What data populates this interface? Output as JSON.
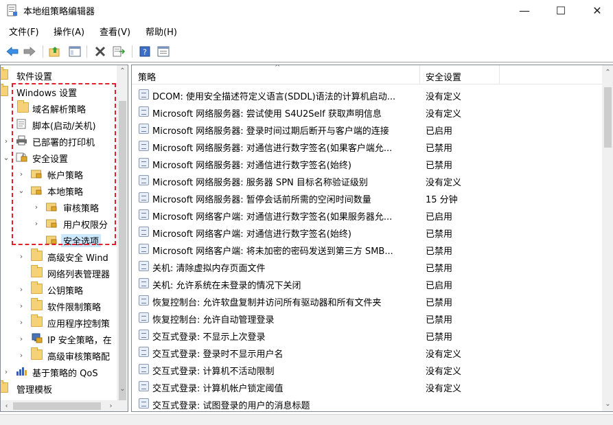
{
  "window": {
    "title": "本地组策略编辑器",
    "minimize": "—",
    "maximize": "☐",
    "close": "✕"
  },
  "menu": [
    {
      "label": "文件(F)"
    },
    {
      "label": "操作(A)"
    },
    {
      "label": "查看(V)"
    },
    {
      "label": "帮助(H)"
    }
  ],
  "toolbar": {
    "icons": [
      "back-icon",
      "forward-icon",
      "up-folder-icon",
      "show-hide-tree-icon",
      "delete-icon",
      "export-list-icon",
      "help-icon",
      "properties-view-icon"
    ]
  },
  "tree": {
    "items": [
      {
        "label": "软件设置"
      },
      {
        "label": "Windows 设置"
      },
      {
        "label": "域名解析策略"
      },
      {
        "label": "脚本(启动/关机)"
      },
      {
        "label": "已部署的打印机"
      },
      {
        "label": "安全设置"
      },
      {
        "label": "帐户策略"
      },
      {
        "label": "本地策略"
      },
      {
        "label": "审核策略"
      },
      {
        "label": "用户权限分"
      },
      {
        "label": "安全选项"
      },
      {
        "label": "高级安全 Wind"
      },
      {
        "label": "网络列表管理器"
      },
      {
        "label": "公钥策略"
      },
      {
        "label": "软件限制策略"
      },
      {
        "label": "应用程序控制策"
      },
      {
        "label": "IP 安全策略，在"
      },
      {
        "label": "高级审核策略配"
      },
      {
        "label": "基于策略的 QoS"
      },
      {
        "label": "管理模板"
      }
    ]
  },
  "list": {
    "columns": {
      "policy": "策略",
      "setting": "安全设置"
    },
    "rows": [
      {
        "policy": "DCOM: 使用安全描述符定义语言(SDDL)语法的计算机启动...",
        "setting": "没有定义"
      },
      {
        "policy": "Microsoft 网络服务器: 尝试使用 S4U2Self 获取声明信息",
        "setting": "没有定义"
      },
      {
        "policy": "Microsoft 网络服务器: 登录时间过期后断开与客户端的连接",
        "setting": "已启用"
      },
      {
        "policy": "Microsoft 网络服务器: 对通信进行数字签名(如果客户端允...",
        "setting": "已禁用"
      },
      {
        "policy": "Microsoft 网络服务器: 对通信进行数字签名(始终)",
        "setting": "已禁用"
      },
      {
        "policy": "Microsoft 网络服务器: 服务器 SPN 目标名称验证级别",
        "setting": "没有定义"
      },
      {
        "policy": "Microsoft 网络服务器: 暂停会话前所需的空闲时间数量",
        "setting": "15 分钟"
      },
      {
        "policy": "Microsoft 网络客户端: 对通信进行数字签名(如果服务器允...",
        "setting": "已启用"
      },
      {
        "policy": "Microsoft 网络客户端: 对通信进行数字签名(始终)",
        "setting": "已禁用"
      },
      {
        "policy": "Microsoft 网络客户端: 将未加密的密码发送到第三方 SMB...",
        "setting": "已禁用"
      },
      {
        "policy": "关机: 清除虚拟内存页面文件",
        "setting": "已禁用"
      },
      {
        "policy": "关机: 允许系统在未登录的情况下关闭",
        "setting": "已启用"
      },
      {
        "policy": "恢复控制台: 允许软盘复制并访问所有驱动器和所有文件夹",
        "setting": "已禁用"
      },
      {
        "policy": "恢复控制台: 允许自动管理登录",
        "setting": "已禁用"
      },
      {
        "policy": "交互式登录: 不显示上次登录",
        "setting": "已禁用"
      },
      {
        "policy": "交互式登录: 登录时不显示用户名",
        "setting": "没有定义"
      },
      {
        "policy": "交互式登录: 计算机不活动限制",
        "setting": "没有定义"
      },
      {
        "policy": "交互式登录: 计算机帐户锁定阈值",
        "setting": "没有定义"
      },
      {
        "policy": "交互式登录: 试图登录的用户的消息标题",
        "setting": ""
      }
    ]
  },
  "colors": {
    "selection": "#cce8ff",
    "highlight_box": "#e0202a",
    "folder": "#f5d27a"
  }
}
